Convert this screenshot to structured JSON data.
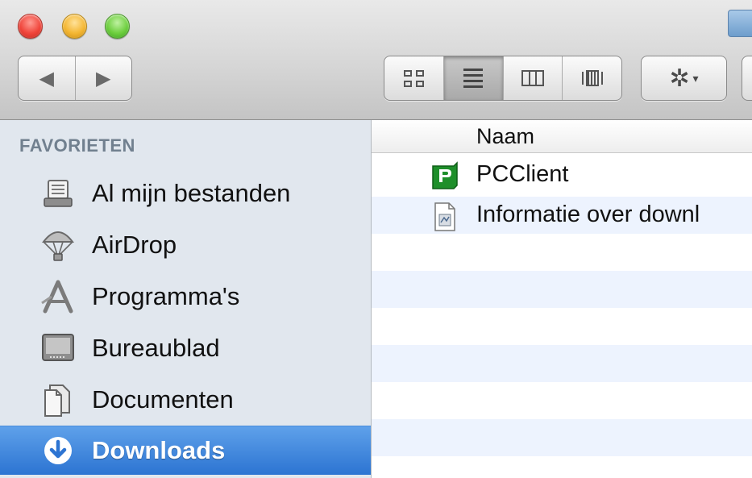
{
  "window": {
    "toolbar": {
      "nav": {
        "back_icon": "back-arrow-icon",
        "forward_icon": "forward-arrow-icon"
      },
      "view_modes": [
        {
          "name": "icon-view",
          "icon": "grid-icon",
          "active": false
        },
        {
          "name": "list-view",
          "icon": "list-icon",
          "active": true
        },
        {
          "name": "column-view",
          "icon": "columns-icon",
          "active": false
        },
        {
          "name": "coverflow-view",
          "icon": "coverflow-icon",
          "active": false
        }
      ],
      "action": {
        "icon": "gear-icon",
        "caret": "▾"
      }
    }
  },
  "sidebar": {
    "section_title": "FAVORIETEN",
    "items": [
      {
        "label": "Al mijn bestanden",
        "icon": "all-files-icon",
        "selected": false
      },
      {
        "label": "AirDrop",
        "icon": "airdrop-icon",
        "selected": false
      },
      {
        "label": "Programma's",
        "icon": "applications-icon",
        "selected": false
      },
      {
        "label": "Bureaublad",
        "icon": "desktop-icon",
        "selected": false
      },
      {
        "label": "Documenten",
        "icon": "documents-icon",
        "selected": false
      },
      {
        "label": "Downloads",
        "icon": "downloads-icon",
        "selected": true
      }
    ],
    "selected_color": "#3b82dc"
  },
  "file_list": {
    "column_name": "Naam",
    "rows": [
      {
        "name": "PCClient",
        "icon": "pcclient-app-icon"
      },
      {
        "name": "Informatie over downl",
        "icon": "document-file-icon"
      }
    ],
    "stripe_color": "#edf3fe"
  }
}
